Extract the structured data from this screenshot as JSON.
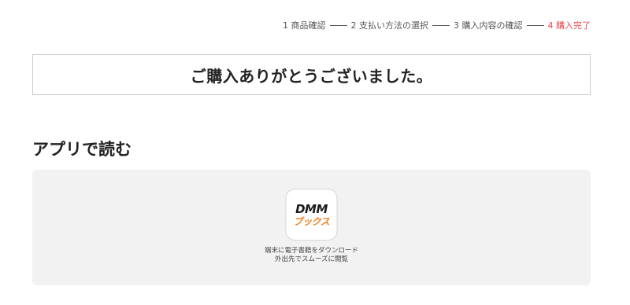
{
  "steps": [
    {
      "label": "1 商品確認"
    },
    {
      "label": "2 支払い方法の選択"
    },
    {
      "label": "3 購入内容の確認"
    },
    {
      "label": "4 購入完了"
    }
  ],
  "active_step_index": 3,
  "colors": {
    "active_step": "#e8474b",
    "panel_bg": "#f2f2f2",
    "brand_orange": "#ef7f1a"
  },
  "thanks": {
    "message": "ご購入ありがとうございました。"
  },
  "app_section": {
    "title": "アプリで読む",
    "app": {
      "logo_top": "DMM",
      "logo_bottom": "ブックス",
      "icon": "dmm-books-app-icon",
      "caption_line1": "端末に電子書籍をダウンロード",
      "caption_line2": "外出先でスムーズに閲覧"
    }
  }
}
